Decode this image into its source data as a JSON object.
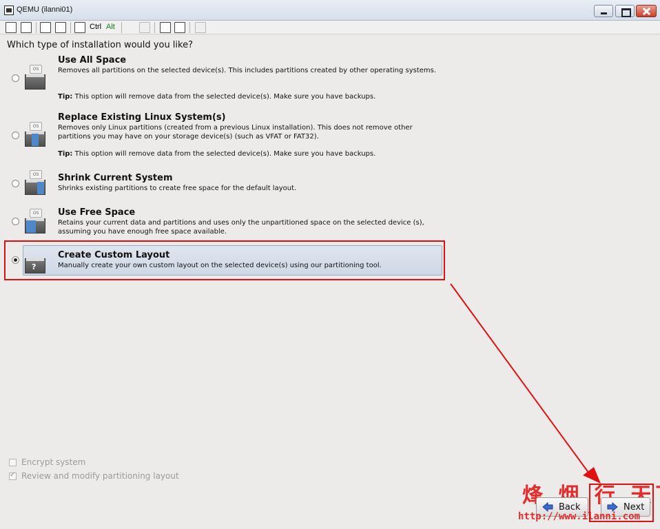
{
  "window": {
    "title": "QEMU (ilanni01)"
  },
  "toolbar": {
    "ctrl_label": "Ctrl",
    "alt_label": "Alt"
  },
  "installer": {
    "question": "Which type of installation would you like?",
    "icon_tag": "OS",
    "options": [
      {
        "title": "Use All Space",
        "description": "Removes all partitions on the selected device(s).  This includes partitions created by other operating systems.",
        "tip_label": "Tip:",
        "tip": "This option will remove data from the selected device(s).  Make sure you have backups.",
        "selected": false
      },
      {
        "title": "Replace Existing Linux System(s)",
        "description": "Removes only Linux partitions (created from a previous Linux installation).  This does not remove other partitions you may have on your storage device(s) (such as VFAT or FAT32).",
        "tip_label": "Tip:",
        "tip": "This option will remove data from the selected device(s).  Make sure you have backups.",
        "selected": false
      },
      {
        "title": "Shrink Current System",
        "description": "Shrinks existing partitions to create free space for the default layout.",
        "selected": false
      },
      {
        "title": "Use Free Space",
        "description": "Retains your current data and partitions and uses only the unpartitioned space on the selected device (s), assuming you have enough free space available.",
        "selected": false
      },
      {
        "title": "Create Custom Layout",
        "description": "Manually create your own custom layout on the selected device(s) using our partitioning tool.",
        "icon_mark": "?",
        "selected": true
      }
    ],
    "encrypt_label": "Encrypt system",
    "encrypt_checked": false,
    "review_label": "Review and modify partitioning layout",
    "review_checked": true,
    "back_label": "Back",
    "next_label": "Next"
  },
  "watermark": {
    "text": "烽 烟 行 天下",
    "url": "http://www.ilanni.com"
  },
  "colors": {
    "annotation_red": "#e01010",
    "selected_bg": "#d6dee9",
    "window_bg": "#ecebe9"
  }
}
